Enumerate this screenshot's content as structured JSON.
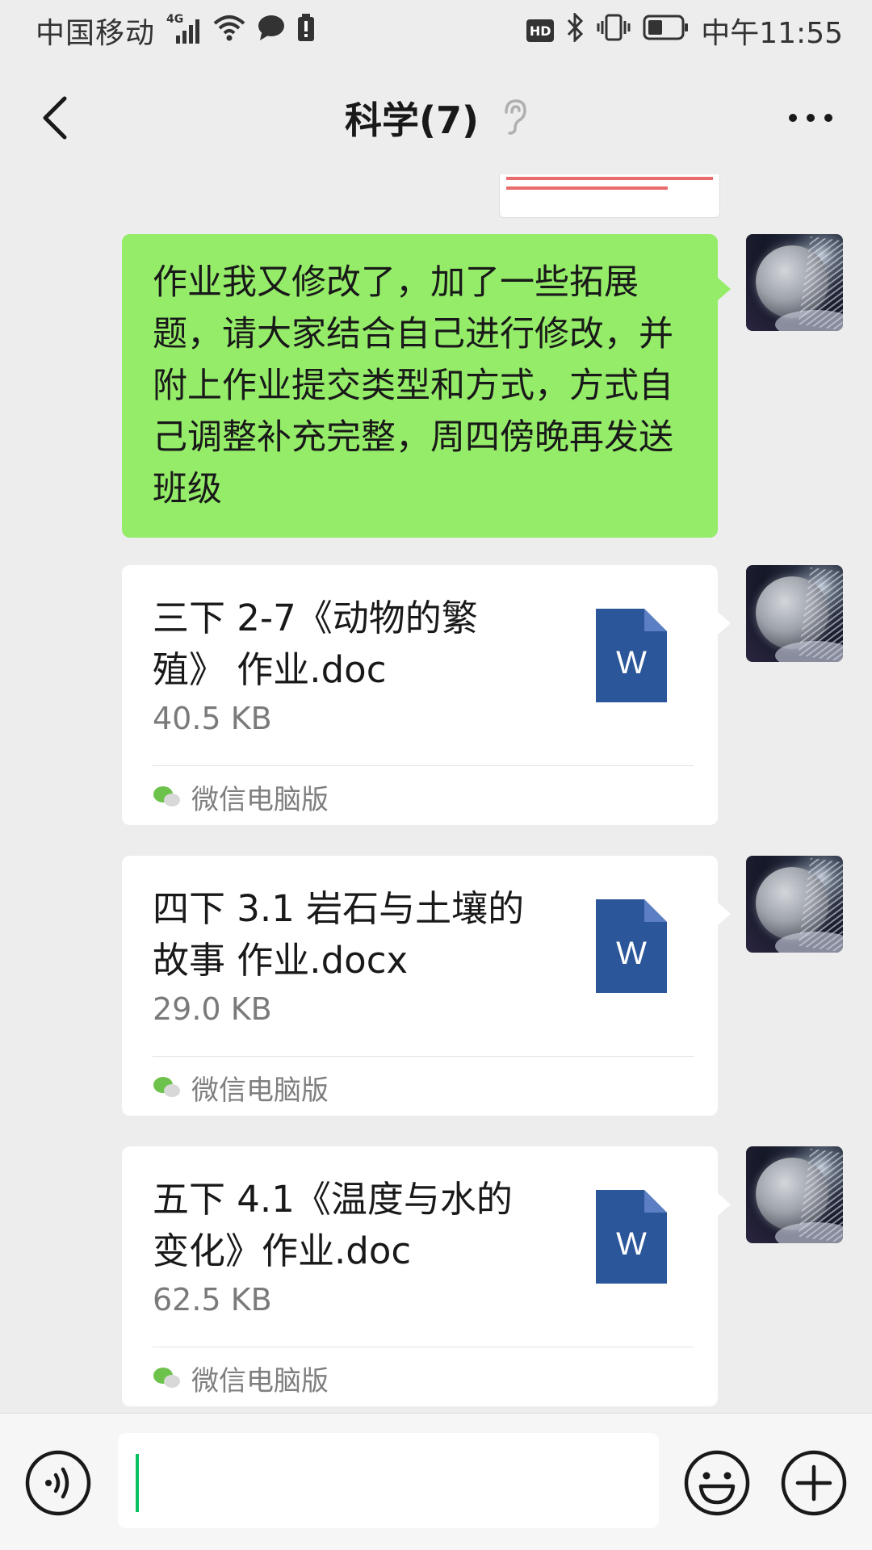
{
  "status_bar": {
    "carrier": "中国移动",
    "network": "4G",
    "hd_badge": "HD",
    "time": "中午11:55",
    "icons": [
      "signal-icon",
      "wifi-icon",
      "message-icon",
      "alert-battery-icon",
      "hd-icon",
      "bluetooth-icon",
      "vibrate-icon",
      "battery-icon"
    ]
  },
  "nav": {
    "title": "科学(7)",
    "back_icon": "chevron-left-icon",
    "mute_icon": "ear-icon",
    "more_icon": "more-icon"
  },
  "messages": [
    {
      "type": "text",
      "text": "作业我又修改了，加了一些拓展题，请大家结合自己进行修改，并附上作业提交类型和方式，方式自己调整补充完整，周四傍晚再发送班级",
      "color": "#95ec69"
    },
    {
      "type": "file",
      "name": "三下 2-7《动物的繁殖》 作业.doc",
      "size": "40.5 KB",
      "source": "微信电脑版",
      "icon": "word-doc-icon"
    },
    {
      "type": "file",
      "name": "四下 3.1 岩石与土壤的故事  作业.docx",
      "size": "29.0 KB",
      "source": "微信电脑版",
      "icon": "word-doc-icon"
    },
    {
      "type": "file",
      "name": "五下 4.1《温度与水的变化》作业.doc",
      "size": "62.5 KB",
      "source": "微信电脑版",
      "icon": "word-doc-icon"
    }
  ],
  "input_bar": {
    "voice_icon": "voice-icon",
    "emoji_icon": "emoji-icon",
    "plus_icon": "plus-icon"
  },
  "colors": {
    "background": "#ededed",
    "bubble_green": "#95ec69",
    "word_blue": "#2b579a",
    "wechat_green": "#07c160"
  }
}
